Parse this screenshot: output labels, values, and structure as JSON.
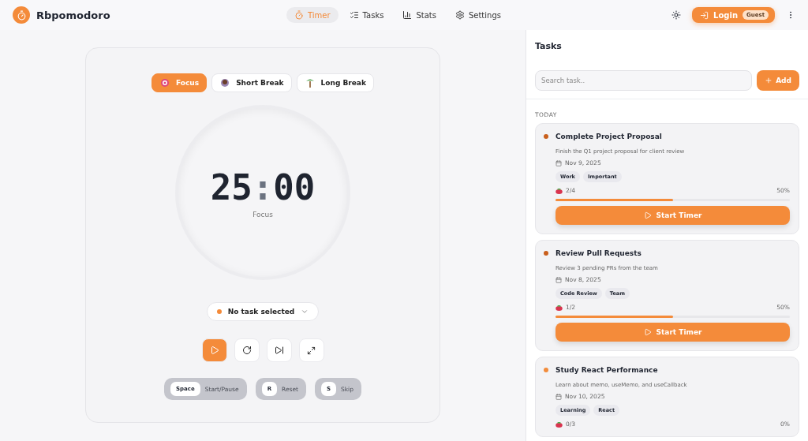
{
  "app": {
    "name": "Rbpomodoro"
  },
  "nav": [
    {
      "label": "Timer",
      "kind": "timer",
      "selected": true
    },
    {
      "label": "Tasks",
      "kind": "tasks",
      "selected": false
    },
    {
      "label": "Stats",
      "kind": "stats",
      "selected": false
    },
    {
      "label": "Settings",
      "kind": "settings",
      "selected": false
    }
  ],
  "login": {
    "label": "Login",
    "badge": "Guest"
  },
  "modes": [
    {
      "label": "Focus",
      "kind": "focus",
      "selected": true
    },
    {
      "label": "Short Break",
      "kind": "short",
      "selected": false
    },
    {
      "label": "Long Break",
      "kind": "long",
      "selected": false
    }
  ],
  "timer": {
    "minutes": "25",
    "separator": ":",
    "seconds": "00",
    "label": "Focus"
  },
  "task_select": {
    "label": "No task selected"
  },
  "shortcuts": [
    {
      "key": "Space",
      "action": "Start/Pause"
    },
    {
      "key": "R",
      "action": "Reset"
    },
    {
      "key": "S",
      "action": "Skip"
    }
  ],
  "tasks_panel": {
    "title": "Tasks",
    "search_placeholder": "Search task..",
    "add_label": "Add",
    "section": "TODAY",
    "tasks": [
      {
        "title": "Complete Project Proposal",
        "color": "#c95f1c",
        "description": "Finish the Q1 project proposal for client review",
        "date": "Nov 9, 2025",
        "tags": [
          "Work",
          "Important"
        ],
        "count": "2/4",
        "percent": "50%",
        "level": 0.5,
        "button": "Start Timer"
      },
      {
        "title": "Review Pull Requests",
        "color": "#c95f1c",
        "description": "Review 3 pending PRs from the team",
        "date": "Nov 8, 2025",
        "tags": [
          "Code Review",
          "Team"
        ],
        "count": "1/2",
        "percent": "50%",
        "level": 0.5,
        "button": "Start Timer"
      },
      {
        "title": "Study React Performance",
        "color": "#f28c3c",
        "description": "Learn about memo, useMemo, and useCallback",
        "date": "Nov 10, 2025",
        "tags": [
          "Learning",
          "React"
        ],
        "count": "0/3",
        "percent": "0%"
      }
    ]
  }
}
